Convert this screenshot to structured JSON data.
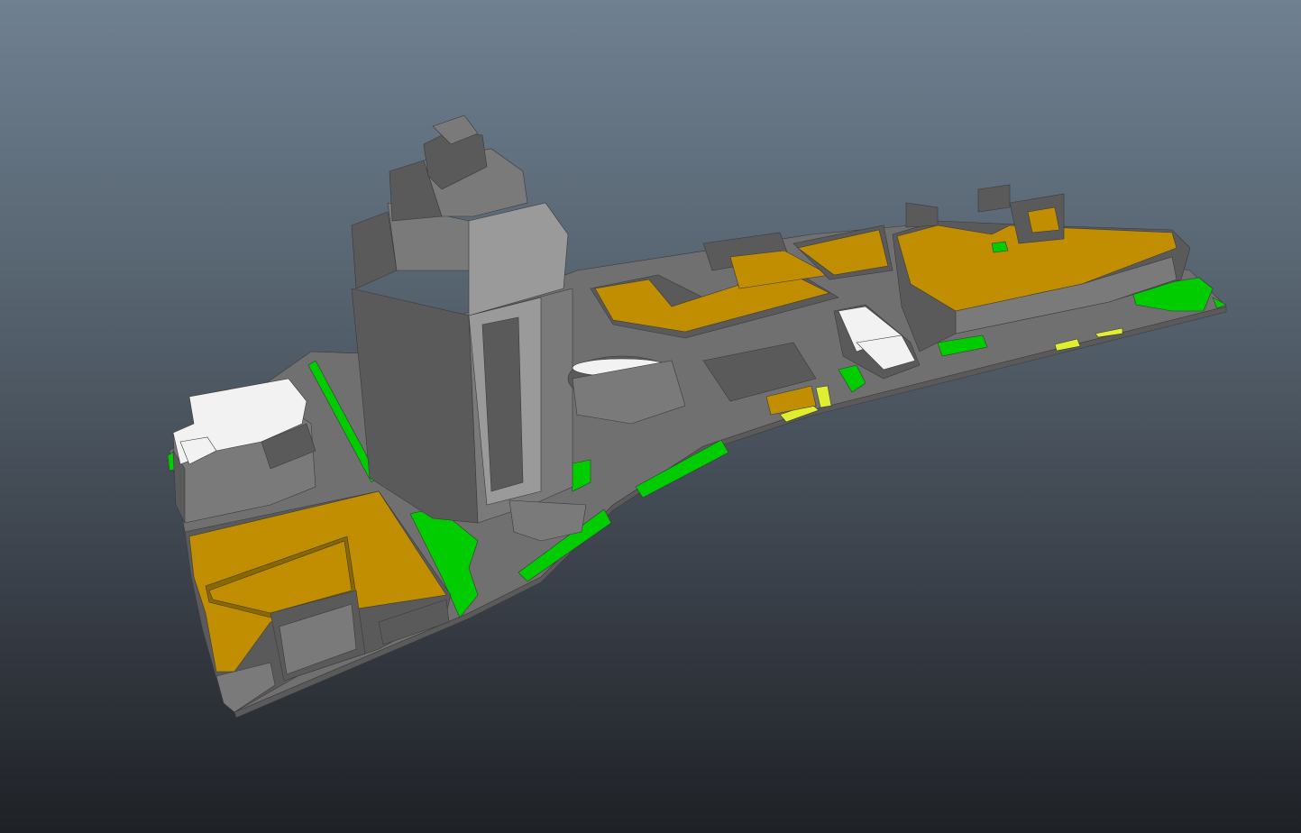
{
  "viewport": {
    "background_top": "#6f8091",
    "background_bottom": "#1e2126"
  },
  "materials": {
    "roof": "#c08e00",
    "roof_dark": "#8a6800",
    "concrete": "#7a7a7a",
    "concrete_dark": "#5a5a5a",
    "concrete_light": "#9a9a9a",
    "ground": "#707070",
    "grass": "#00cc00",
    "white_roof": "#f2f2f2",
    "yellow": "#e0ee30",
    "water": "#2ab0e0"
  },
  "scene": {
    "object_names": [
      "ground-plate",
      "tower",
      "west-roof-block",
      "white-roof-building",
      "central-roof-block",
      "east-roof-complex",
      "rotunda",
      "small-white-roof",
      "grass-strips"
    ]
  }
}
